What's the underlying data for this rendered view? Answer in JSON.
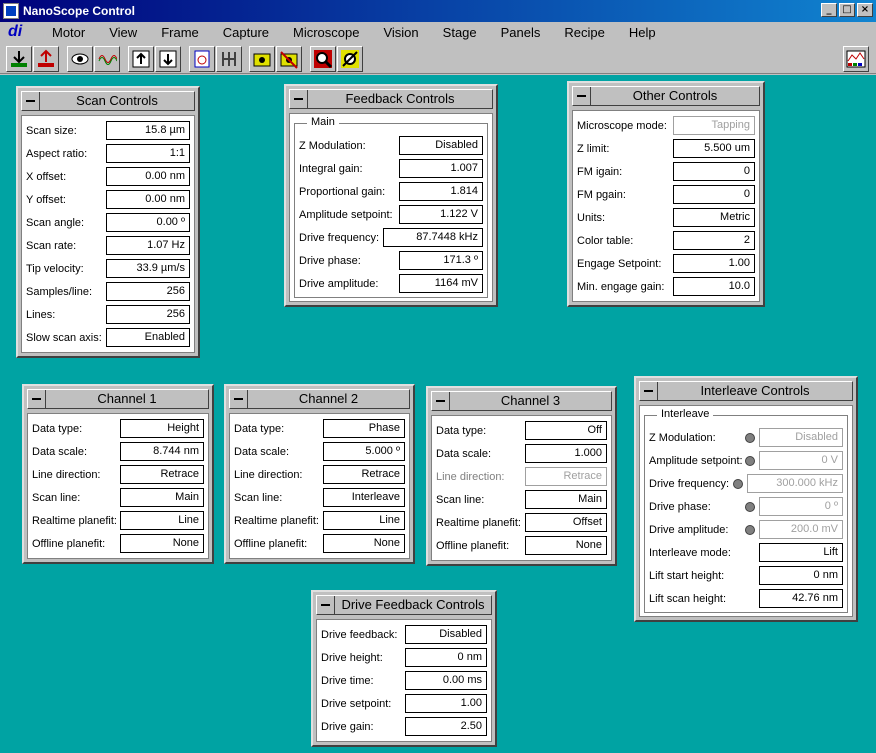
{
  "window": {
    "title": "NanoScope Control",
    "brand": "di",
    "buttons": [
      "_",
      "□",
      "×"
    ]
  },
  "menu": [
    "Motor",
    "View",
    "Frame",
    "Capture",
    "Microscope",
    "Vision",
    "Stage",
    "Panels",
    "Recipe",
    "Help"
  ],
  "toolbar": [
    "engage-icon",
    "withdraw-icon",
    "eye-icon",
    "scope-trace-icon",
    "frame-up-icon",
    "frame-down-icon",
    "timer-icon",
    "tip-icon",
    "camera-icon",
    "camera-off-icon",
    "zoom-icon",
    "offset-icon",
    "palette-icon"
  ],
  "scan_controls": {
    "title": "Scan Controls",
    "rows": [
      {
        "label": "Scan size:",
        "value": "15.8 µm"
      },
      {
        "label": "Aspect ratio:",
        "value": "1:1"
      },
      {
        "label": "X offset:",
        "value": "0.00 nm"
      },
      {
        "label": "Y offset:",
        "value": "0.00 nm"
      },
      {
        "label": "Scan angle:",
        "value": "0.00 º"
      },
      {
        "label": "Scan rate:",
        "value": "1.07 Hz"
      },
      {
        "label": "Tip velocity:",
        "value": "33.9 µm/s"
      },
      {
        "label": "Samples/line:",
        "value": "256"
      },
      {
        "label": "Lines:",
        "value": "256"
      },
      {
        "label": "Slow scan axis:",
        "value": "Enabled"
      }
    ]
  },
  "feedback_controls": {
    "title": "Feedback Controls",
    "group": "Main",
    "rows": [
      {
        "label": "Z Modulation:",
        "value": "Disabled"
      },
      {
        "label": "Integral gain:",
        "value": "1.007"
      },
      {
        "label": "Proportional gain:",
        "value": "1.814"
      },
      {
        "label": "Amplitude setpoint:",
        "value": "1.122 V"
      },
      {
        "label": "Drive frequency:",
        "value": "87.7448 kHz"
      },
      {
        "label": "Drive phase:",
        "value": "171.3 º"
      },
      {
        "label": "Drive amplitude:",
        "value": "1164 mV"
      }
    ]
  },
  "other_controls": {
    "title": "Other Controls",
    "rows": [
      {
        "label": "Microscope mode:",
        "value": "Tapping"
      },
      {
        "label": "Z limit:",
        "value": "5.500 um"
      },
      {
        "label": "FM igain:",
        "value": "0"
      },
      {
        "label": "FM pgain:",
        "value": "0"
      },
      {
        "label": "Units:",
        "value": "Metric"
      },
      {
        "label": "Color table:",
        "value": "2"
      },
      {
        "label": "Engage Setpoint:",
        "value": "1.00"
      },
      {
        "label": "Min. engage gain:",
        "value": "10.0"
      }
    ]
  },
  "channel1": {
    "title": "Channel 1",
    "rows": [
      {
        "label": "Data type:",
        "value": "Height"
      },
      {
        "label": "Data scale:",
        "value": "8.744 nm"
      },
      {
        "label": "Line direction:",
        "value": "Retrace"
      },
      {
        "label": "Scan line:",
        "value": "Main"
      },
      {
        "label": "Realtime planefit:",
        "value": "Line"
      },
      {
        "label": "Offline planefit:",
        "value": "None"
      }
    ]
  },
  "channel2": {
    "title": "Channel 2",
    "rows": [
      {
        "label": "Data type:",
        "value": "Phase"
      },
      {
        "label": "Data scale:",
        "value": "5.000 º"
      },
      {
        "label": "Line direction:",
        "value": "Retrace"
      },
      {
        "label": "Scan line:",
        "value": "Interleave"
      },
      {
        "label": "Realtime planefit:",
        "value": "Line"
      },
      {
        "label": "Offline planefit:",
        "value": "None"
      }
    ]
  },
  "channel3": {
    "title": "Channel 3",
    "rows": [
      {
        "label": "Data type:",
        "value": "Off"
      },
      {
        "label": "Data scale:",
        "value": "1.000"
      },
      {
        "label": "Line direction:",
        "value": "Retrace"
      },
      {
        "label": "Scan line:",
        "value": "Main"
      },
      {
        "label": "Realtime planefit:",
        "value": "Offset"
      },
      {
        "label": "Offline planefit:",
        "value": "None"
      }
    ]
  },
  "interleave_controls": {
    "title": "Interleave Controls",
    "group": "Interleave",
    "rows": [
      {
        "label": "Z Modulation:",
        "value": "Disabled"
      },
      {
        "label": "Amplitude setpoint:",
        "value": "0 V"
      },
      {
        "label": "Drive frequency:",
        "value": "300.000 kHz"
      },
      {
        "label": "Drive phase:",
        "value": "0 º"
      },
      {
        "label": "Drive amplitude:",
        "value": "200.0 mV"
      },
      {
        "label": "Interleave mode:",
        "value": "Lift"
      },
      {
        "label": "Lift start height:",
        "value": "0 nm"
      },
      {
        "label": "Lift scan height:",
        "value": "42.76 nm"
      }
    ]
  },
  "drive_feedback_controls": {
    "title": "Drive Feedback Controls",
    "rows": [
      {
        "label": "Drive feedback:",
        "value": "Disabled"
      },
      {
        "label": "Drive height:",
        "value": "0 nm"
      },
      {
        "label": "Drive time:",
        "value": "0.00 ms"
      },
      {
        "label": "Drive setpoint:",
        "value": "1.00"
      },
      {
        "label": "Drive gain:",
        "value": "2.50"
      }
    ]
  },
  "colors": {
    "workspace": "#00a3a3",
    "titlebar": "#00007b",
    "panel": "#c0c0c0"
  }
}
